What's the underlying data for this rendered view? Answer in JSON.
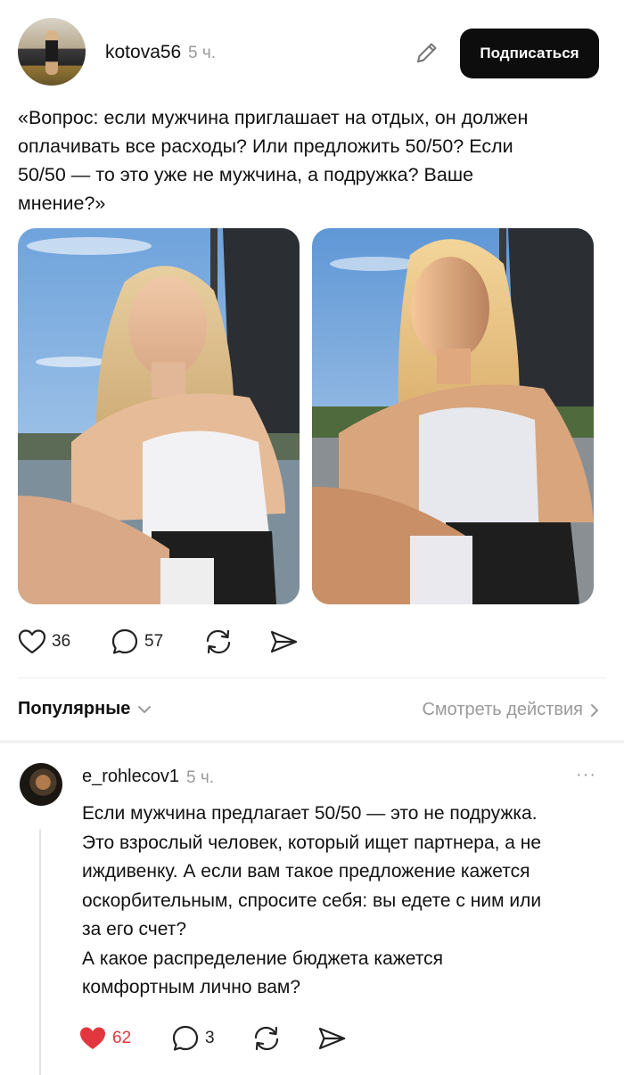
{
  "post": {
    "author": "kotova56",
    "time": "5 ч.",
    "subscribe_label": "Подписаться",
    "text_lines": [
      "«Вопрос: если мужчина приглашает на отдых, он должен",
      "оплачивать все расходы? Или предложить 50/50? Если",
      "50/50 — то это уже не мужчина, а подружка? Ваше",
      "мнение?»"
    ],
    "photo_count": 2,
    "likes": "36",
    "comments": "57"
  },
  "sort": {
    "label": "Популярные",
    "view_actions_label": "Смотреть действия"
  },
  "comment": {
    "author": "e_rohlecov1",
    "time": "5 ч.",
    "more": "···",
    "text_lines": [
      "Если мужчина предлагает 50/50 — это не подружка.",
      "Это взрослый человек, который ищет партнера, а не",
      "иждивенку. А если вам такое предложение кажется",
      "оскорбительным, спросите себя: вы едете с ним или",
      "за его счет?",
      "А какое распределение бюджета кажется",
      "комфортным лично вам?"
    ],
    "likes": "62",
    "replies": "3",
    "liked": true
  },
  "icons": {
    "like": "heart-icon",
    "comment": "comment-bubble-icon",
    "repost": "repost-icon",
    "share": "send-icon",
    "edit": "pencil-icon"
  },
  "colors": {
    "accent_like": "#e2373f",
    "button_bg": "#0d0d0d",
    "muted": "#9a9a9a"
  }
}
